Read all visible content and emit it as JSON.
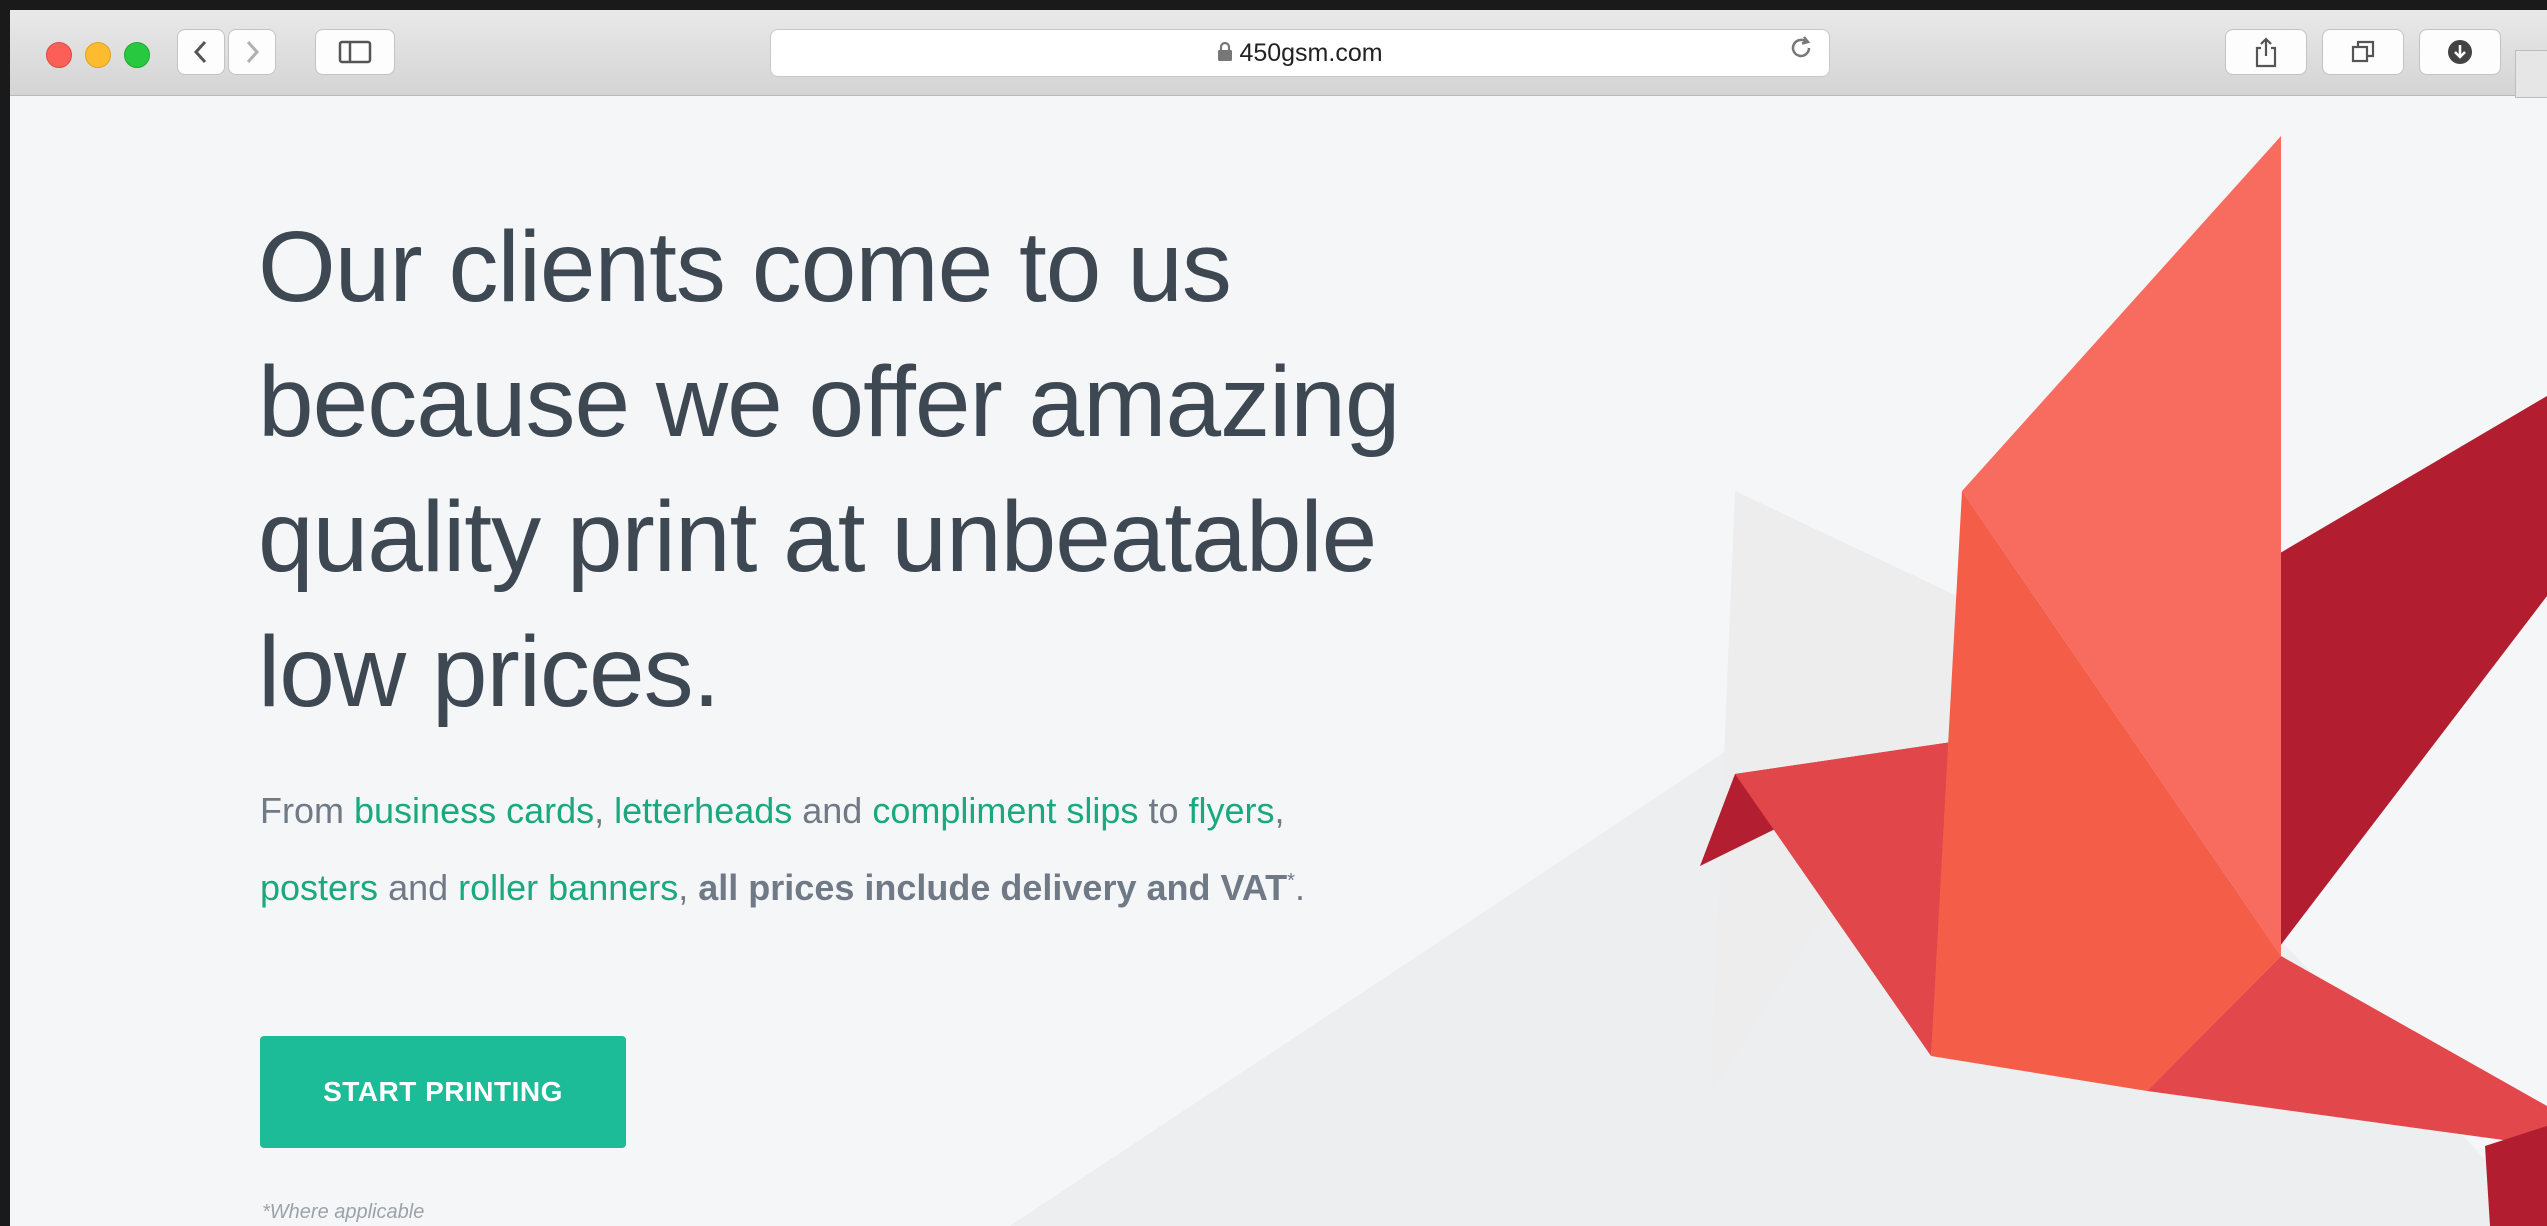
{
  "browser": {
    "url": "450gsm.com"
  },
  "hero": {
    "headline_lines": [
      "Our clients come to us",
      "because we offer amazing",
      "quality print at unbeatable",
      "low prices."
    ],
    "intro": {
      "from": "From ",
      "business_cards": "business cards",
      "comma1": ", ",
      "letterheads": "letterheads",
      "and1": " and ",
      "compliment_slips": "compliment slips",
      "to": " to ",
      "flyers": "flyers",
      "comma2": ",",
      "posters": "posters",
      "and2": " and ",
      "roller_banners": "roller banners",
      "comma3": ", ",
      "all_prices": "all prices include delivery and VAT",
      "asterisk": "*",
      "period": "."
    },
    "cta_label": "START PRINTING",
    "footnote": "*Where applicable"
  },
  "colors": {
    "accent": "#1bbc97",
    "link": "#1aa97f",
    "heading": "#3d4852"
  },
  "icons": [
    "close-light",
    "minimize-light",
    "zoom-light",
    "back-icon",
    "forward-icon",
    "sidebar-icon",
    "lock-icon",
    "reload-icon",
    "share-icon",
    "tabs-icon",
    "download-icon"
  ]
}
